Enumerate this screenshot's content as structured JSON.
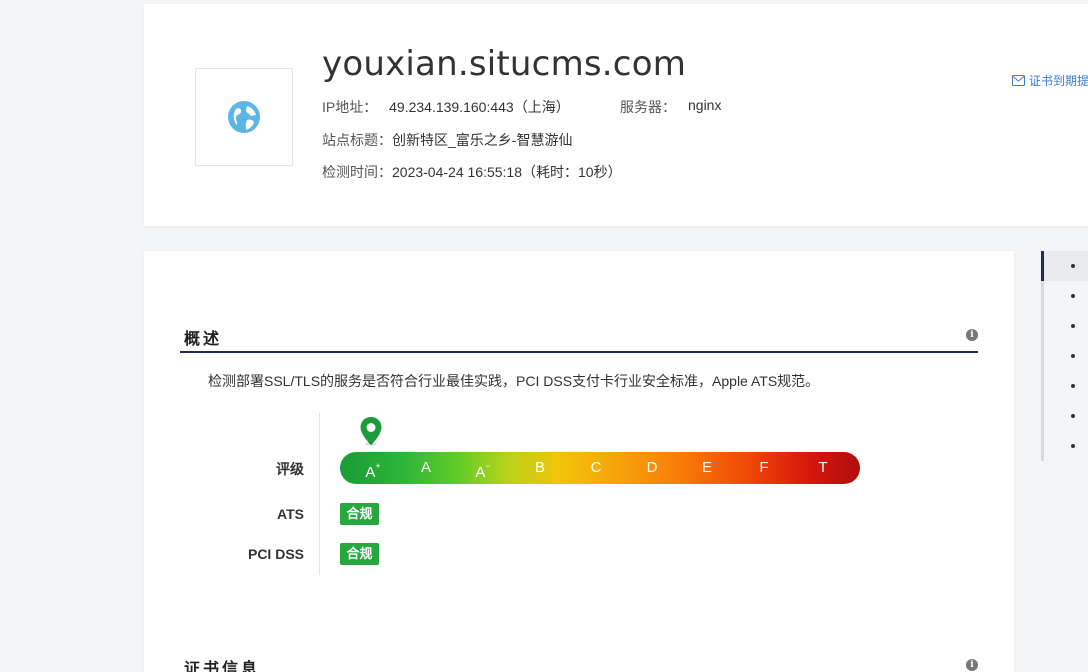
{
  "header": {
    "domain": "youxian.situcms.com",
    "ip_label": "IP地址：",
    "ip_value": "49.234.139.160:443（上海）",
    "server_label": "服务器：",
    "server_value": "nginx",
    "site_title_label": "站点标题：",
    "site_title_value": "创新特区_富乐之乡-智慧游仙",
    "check_time_label": "检测时间：",
    "check_time_value": "2023-04-24 16:55:18（耗时：10秒）",
    "cert_link": "证书到期提"
  },
  "overview": {
    "title": "概述",
    "description": "检测部署SSL/TLS的服务是否符合行业最佳实践，PCI DSS支付卡行业安全标准，Apple ATS规范。",
    "rating_label": "评级",
    "grades": [
      "A+",
      "A",
      "A-",
      "B",
      "C",
      "D",
      "E",
      "F",
      "T"
    ],
    "current_grade": "A+",
    "ats_label": "ATS",
    "ats_status": "合规",
    "pci_label": "PCI DSS",
    "pci_status": "合规"
  },
  "cert_section": {
    "title": "证书信息"
  },
  "side_nav": {
    "items": [
      "",
      "",
      "",
      "",
      "",
      "",
      ""
    ],
    "active_index": 0
  },
  "colors": {
    "accent_navy": "#1f2b54",
    "compliant_green": "#27a83e",
    "link_blue": "#3a7bd5"
  }
}
